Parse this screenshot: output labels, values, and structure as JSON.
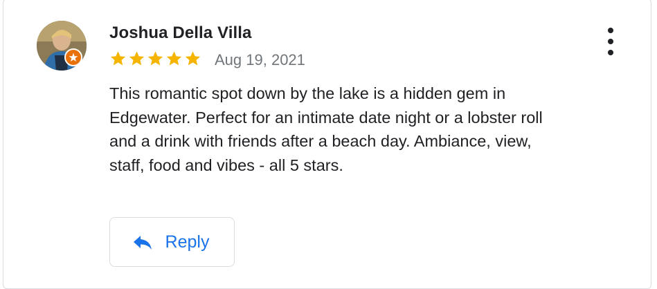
{
  "review": {
    "reviewer_name": "Joshua Della Villa",
    "rating": 5,
    "rating_max": 5,
    "date": "Aug 19, 2021",
    "text": "This romantic spot down by the lake is a hidden gem in Edgewater. Perfect for an intimate date night or a lobster roll and a drink with friends after a beach day. Ambiance, view, staff, food and vibes - all 5 stars.",
    "reply_label": "Reply"
  },
  "icons": {
    "avatar": "reviewer-avatar",
    "badge": "local-guide-badge-icon",
    "stars": "star-icon",
    "more": "more-vert-icon",
    "reply": "reply-arrow-icon"
  },
  "colors": {
    "star": "#f4b400",
    "accent": "#1a73e8",
    "badge": "#e8710a",
    "text": "#202124",
    "muted": "#70757a",
    "border": "#dadce0"
  }
}
